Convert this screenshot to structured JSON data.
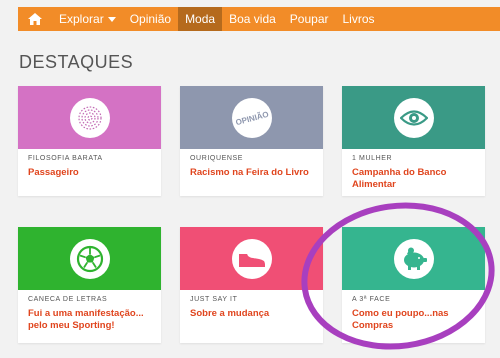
{
  "nav": {
    "items": [
      {
        "label": "Explorar"
      },
      {
        "label": "Opinião"
      },
      {
        "label": "Moda"
      },
      {
        "label": "Boa vida"
      },
      {
        "label": "Poupar"
      },
      {
        "label": "Livros"
      }
    ]
  },
  "section": {
    "title": "DESTAQUES"
  },
  "cards": [
    {
      "category": "FILOSOFIA BARATA",
      "title": "Passageiro",
      "icon": "fingerprint-icon",
      "color": "#d472c4"
    },
    {
      "category": "OURIQUENSE",
      "title": "Racismo na Feira do Livro",
      "icon": "opiniao-icon",
      "icon_text": "OPINIÃO",
      "color": "#8e97ae"
    },
    {
      "category": "1 MULHER",
      "title": "Campanha do Banco Alimentar",
      "icon": "eye-icon",
      "color": "#3a9a86"
    },
    {
      "category": "CANECA DE LETRAS",
      "title": "Fui a uma manifestação... pelo meu Sporting!",
      "icon": "soccer-ball-icon",
      "color": "#2fb32f"
    },
    {
      "category": "JUST SAY IT",
      "title": "Sobre a mudança",
      "icon": "sneaker-icon",
      "color": "#f04f75"
    },
    {
      "category": "A 3ª FACE",
      "title": "Como eu poupo...nas Compras",
      "icon": "piggy-bank-icon",
      "color": "#35b58f"
    }
  ],
  "colors": {
    "nav": "#f28c28",
    "nav_active": "#b56a1d",
    "title_text": "#e0451e",
    "highlight": "#a83fbf"
  }
}
